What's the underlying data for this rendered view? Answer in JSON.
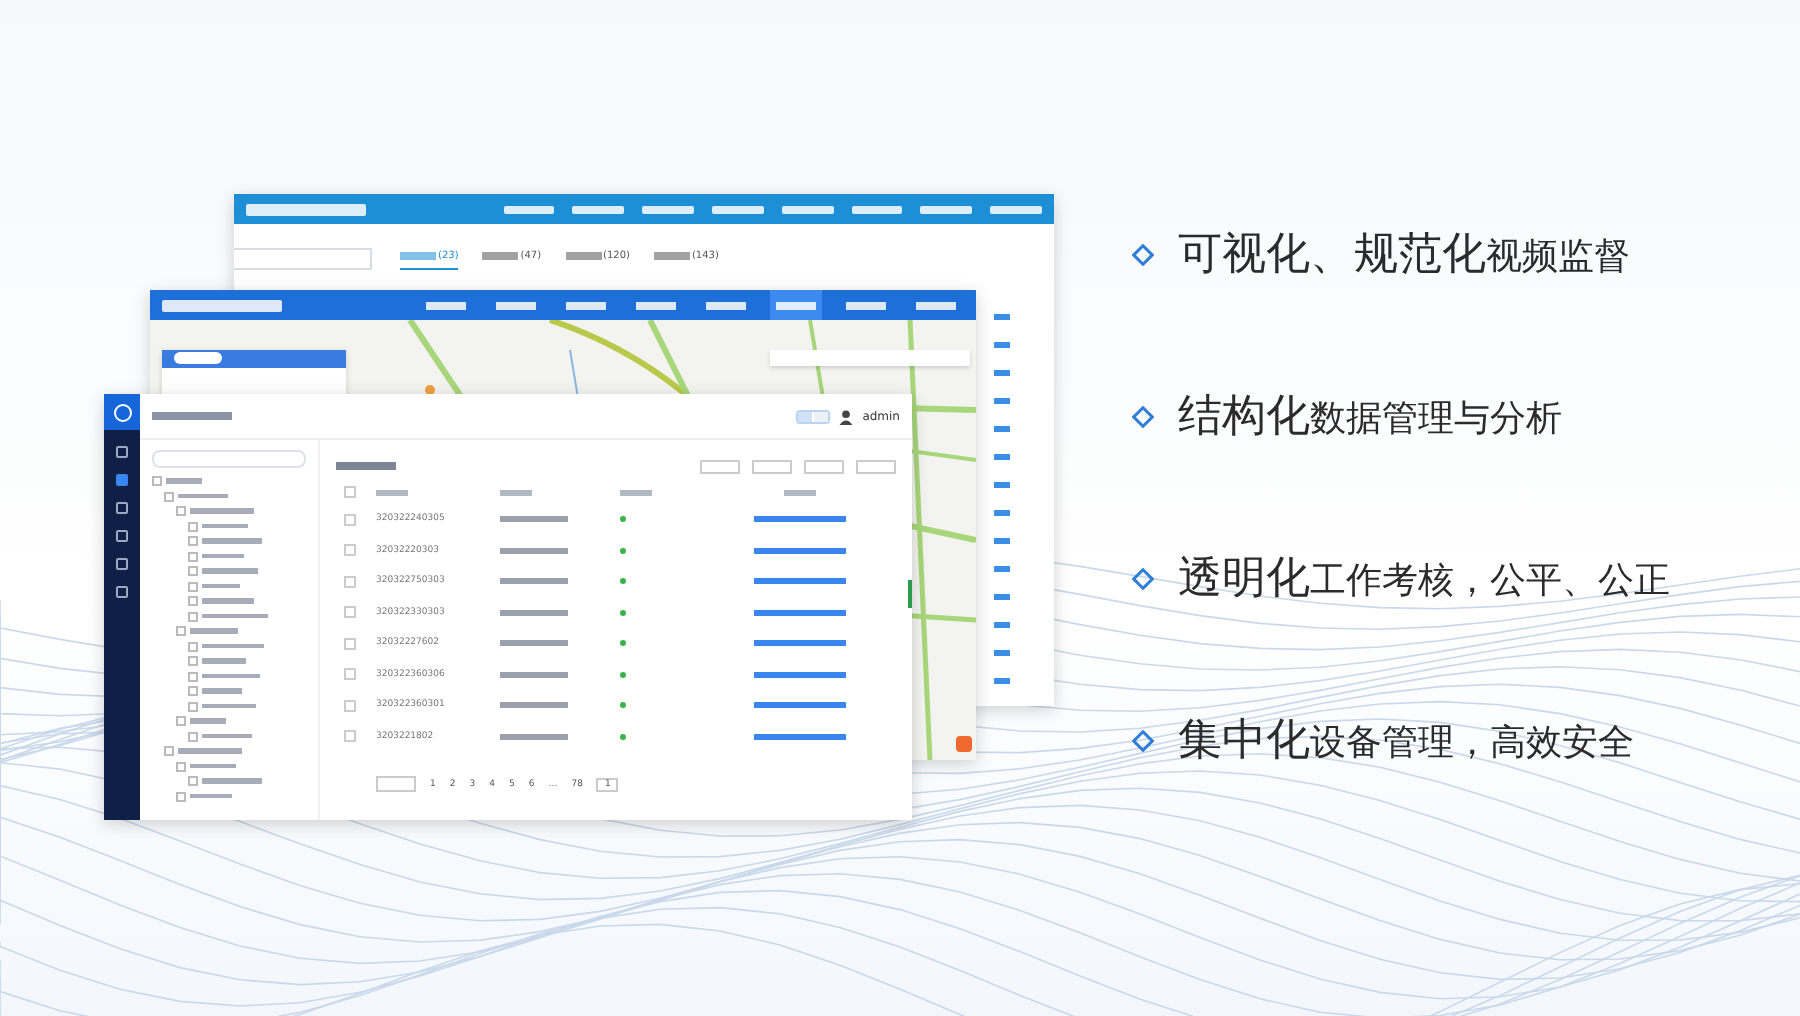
{
  "bullets": [
    {
      "lead": "可视化、规范化",
      "rest": "视频监督"
    },
    {
      "lead": "结构化",
      "rest": "数据管理与分析"
    },
    {
      "lead": "透明化",
      "rest": "工作考核，公平、公正"
    },
    {
      "lead": "集中化",
      "rest": "设备管理，高效安全"
    }
  ],
  "back_window": {
    "tabs": [
      {
        "count": "(23)",
        "selected": true
      },
      {
        "count": "(47)",
        "selected": false
      },
      {
        "count": "(120)",
        "selected": false
      },
      {
        "count": "(143)",
        "selected": false
      }
    ]
  },
  "map_window": {
    "menu": [
      {
        "selected": false
      },
      {
        "selected": false
      },
      {
        "selected": false
      },
      {
        "selected": false
      },
      {
        "selected": false
      },
      {
        "selected": true
      },
      {
        "selected": false
      },
      {
        "selected": false
      }
    ]
  },
  "front_window": {
    "user": "admin",
    "languages": [
      {
        "selected": true
      },
      {
        "selected": false
      }
    ],
    "rows": [
      {
        "id": "320322240305",
        "checked": false
      },
      {
        "id": "32032220303",
        "checked": false
      },
      {
        "id": "320322750303",
        "checked": false
      },
      {
        "id": "320322330303",
        "checked": false
      },
      {
        "id": "32032227602",
        "checked": false
      },
      {
        "id": "320322360306",
        "checked": false
      },
      {
        "id": "320322360301",
        "checked": false
      },
      {
        "id": "3203221802",
        "checked": false
      }
    ],
    "pages": [
      "1",
      "2",
      "3",
      "4",
      "5",
      "6",
      "…",
      "78"
    ],
    "jump": "1"
  }
}
